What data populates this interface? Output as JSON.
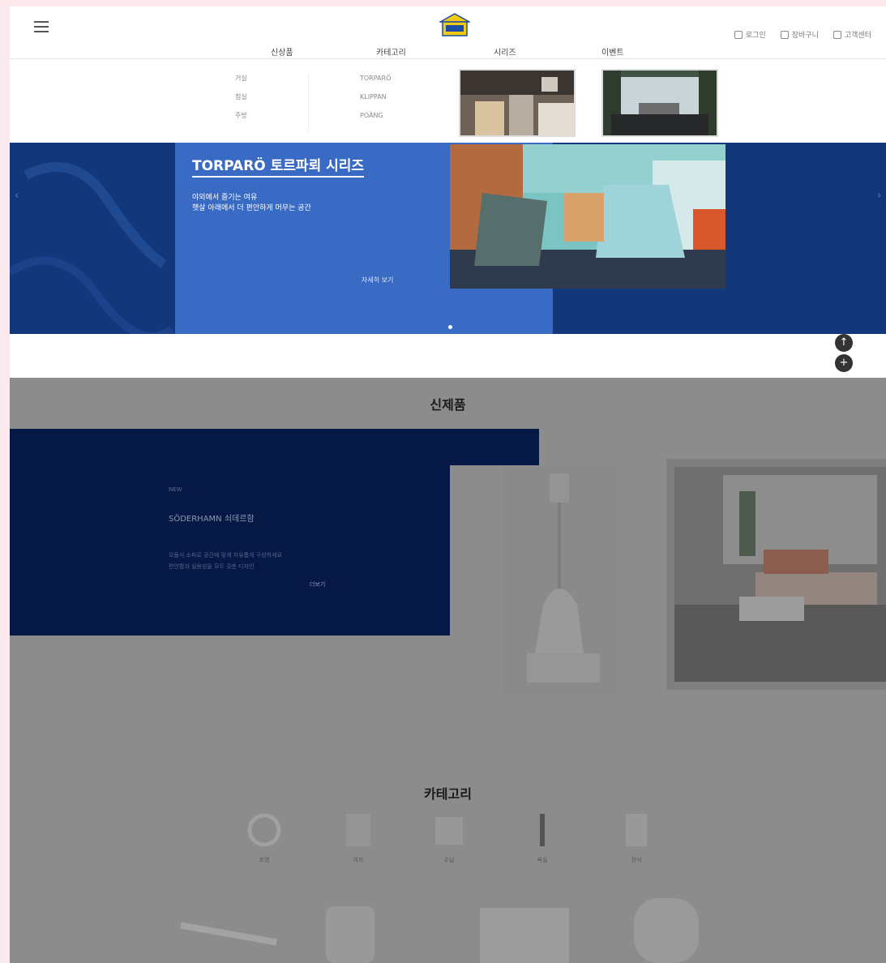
{
  "header": {
    "menu_icon": "hamburger-icon",
    "logo_icon": "house-logo-icon",
    "utils": [
      {
        "label": "로그인",
        "icon": "user-icon"
      },
      {
        "label": "장바구니",
        "icon": "cart-icon"
      },
      {
        "label": "고객센터",
        "icon": "headset-icon"
      }
    ],
    "nav": [
      "신상품",
      "카테고리",
      "시리즈",
      "이벤트"
    ]
  },
  "mega_menu": {
    "col1": [
      "거실",
      "침실",
      "주방"
    ],
    "col2": [
      "TORPARÖ",
      "KLIPPAN",
      "POÄNG"
    ]
  },
  "hero": {
    "title": "TORPARÖ 토르파뢰 시리즈",
    "subtitle_1": "야외에서 즐기는 여유",
    "subtitle_2": "햇살 아래에서 더 편안하게 머무는 공간",
    "more": "자세히 보기"
  },
  "floating": {
    "top_icon": "arrow-up-icon",
    "add_icon": "plus-icon"
  },
  "new_products": {
    "title": "신제품",
    "label": "NEW",
    "name": "SÖDERHAMN 쇠데르함",
    "desc_1": "모듈식 소파로 공간에 맞게 자유롭게 구성하세요",
    "desc_2": "편안함과 실용성을 모두 갖춘 디자인",
    "button": "더보기"
  },
  "categories": {
    "title": "카테고리",
    "items": [
      "조명",
      "의자",
      "수납",
      "욕실",
      "장식"
    ]
  },
  "colors": {
    "hero_dark": "#12377a",
    "hero_panel": "#3a6bc4",
    "new_box": "#061845",
    "accent": "#f2c811"
  }
}
